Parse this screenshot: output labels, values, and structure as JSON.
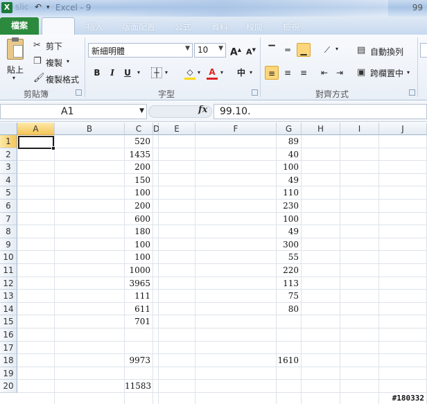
{
  "window": {
    "app_icon": "X",
    "title_left": "slic",
    "title": "Excel - 9",
    "title_right": "99"
  },
  "ribbon_tabs": {
    "file": "檔案",
    "others": [
      "插入",
      "版面配置",
      "公式",
      "資料",
      "校閱",
      "檢視"
    ]
  },
  "clipboard": {
    "paste": "貼上",
    "cut": "剪下",
    "copy": "複製",
    "format_painter": "複製格式",
    "group_label": "剪貼簿"
  },
  "font": {
    "name": "新細明體",
    "size": "10",
    "group_label": "字型",
    "bold": "B",
    "italic": "I",
    "underline": "U",
    "grow": "A",
    "shrink": "A",
    "font_color_letter": "A",
    "phonetic": "中",
    "font_color_hex": "#e02020",
    "fill_color_hex": "#ffd700"
  },
  "alignment": {
    "wrap_text": "自動換列",
    "merge_center": "跨欄置中",
    "group_label": "對齊方式"
  },
  "formula_bar": {
    "name_box": "A1",
    "fx": "fx",
    "formula": "99.10."
  },
  "grid": {
    "columns": [
      "A",
      "B",
      "C",
      "D",
      "E",
      "F",
      "G",
      "H",
      "I",
      "J"
    ],
    "rows": [
      "1",
      "2",
      "3",
      "4",
      "5",
      "6",
      "7",
      "8",
      "9",
      "10",
      "11",
      "12",
      "13",
      "14",
      "15",
      "16",
      "17",
      "18",
      "19",
      "20"
    ],
    "col_c": [
      "520",
      "1435",
      "200",
      "150",
      "100",
      "200",
      "600",
      "180",
      "100",
      "100",
      "1000",
      "3965",
      "111",
      "611",
      "701",
      "",
      "",
      "9973",
      "",
      "11583"
    ],
    "col_g": [
      "89",
      "40",
      "100",
      "49",
      "110",
      "230",
      "100",
      "49",
      "300",
      "55",
      "220",
      "113",
      "75",
      "80",
      "",
      "",
      "",
      "1610",
      "",
      ""
    ]
  },
  "watermark": "#180332"
}
